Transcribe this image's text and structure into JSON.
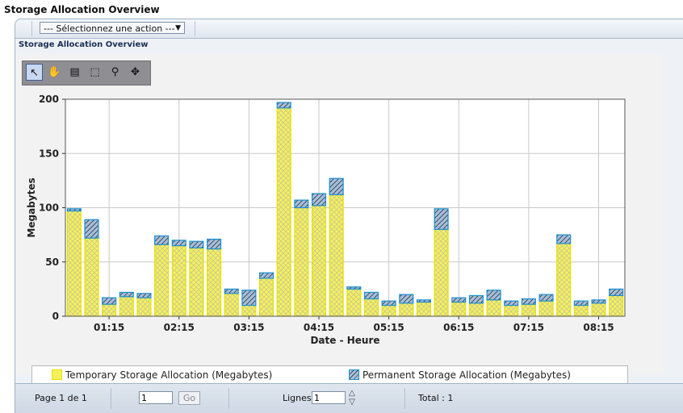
{
  "page": {
    "title": "Storage Allocation Overview"
  },
  "action_bar": {
    "select_label": "--- Sélectionnez une action ---"
  },
  "section": {
    "title": "Storage Allocation Overview"
  },
  "toolbar": {
    "tools": [
      {
        "icon": "select-pointer-icon",
        "glyph": "↖"
      },
      {
        "icon": "hand-pan-icon",
        "glyph": "✋"
      },
      {
        "icon": "annotation-icon",
        "glyph": "▤"
      },
      {
        "icon": "zoom-area-icon",
        "glyph": "⬚"
      },
      {
        "icon": "zoom-icon",
        "glyph": "⚲"
      },
      {
        "icon": "fit-view-icon",
        "glyph": "✥"
      }
    ]
  },
  "chart_data": {
    "type": "bar",
    "stacked": true,
    "xlabel": "Date - Heure",
    "ylabel": "Megabytes",
    "ylim": [
      0,
      200
    ],
    "yticks": [
      0,
      50,
      100,
      150,
      200
    ],
    "xticks": [
      "01:15",
      "02:15",
      "03:15",
      "04:15",
      "05:15",
      "06:15",
      "07:15",
      "08:15"
    ],
    "grid": true,
    "colors": {
      "temporary": "#f5f060",
      "temporary_border": "#e8e000",
      "permanent": "#a8bfd8",
      "permanent_border": "#1a8fd0"
    },
    "series": [
      {
        "name": "Temporary Storage Allocation (Megabytes)",
        "values": [
          97,
          72,
          11,
          18,
          17,
          66,
          65,
          63,
          62,
          21,
          10,
          35,
          192,
          100,
          102,
          112,
          25,
          16,
          10,
          12,
          13,
          80,
          13,
          12,
          15,
          10,
          11,
          14,
          67,
          10,
          12,
          19
        ]
      },
      {
        "name": "Permanent Storage Allocation (Megabytes)",
        "values": [
          2,
          17,
          6,
          4,
          4,
          8,
          5,
          6,
          9,
          4,
          14,
          5,
          5,
          7,
          11,
          15,
          2,
          6,
          4,
          8,
          2,
          19,
          4,
          7,
          9,
          4,
          5,
          6,
          8,
          4,
          3,
          6
        ]
      }
    ]
  },
  "legend": {
    "temporary": "Temporary Storage Allocation (Megabytes)",
    "permanent": "Permanent Storage Allocation (Megabytes)"
  },
  "pager": {
    "page_info": "Page 1 de 1",
    "page_input": "1",
    "go_label": "Go",
    "lines_label": "Lignes",
    "lines_input": "1",
    "total": "Total : 1"
  }
}
